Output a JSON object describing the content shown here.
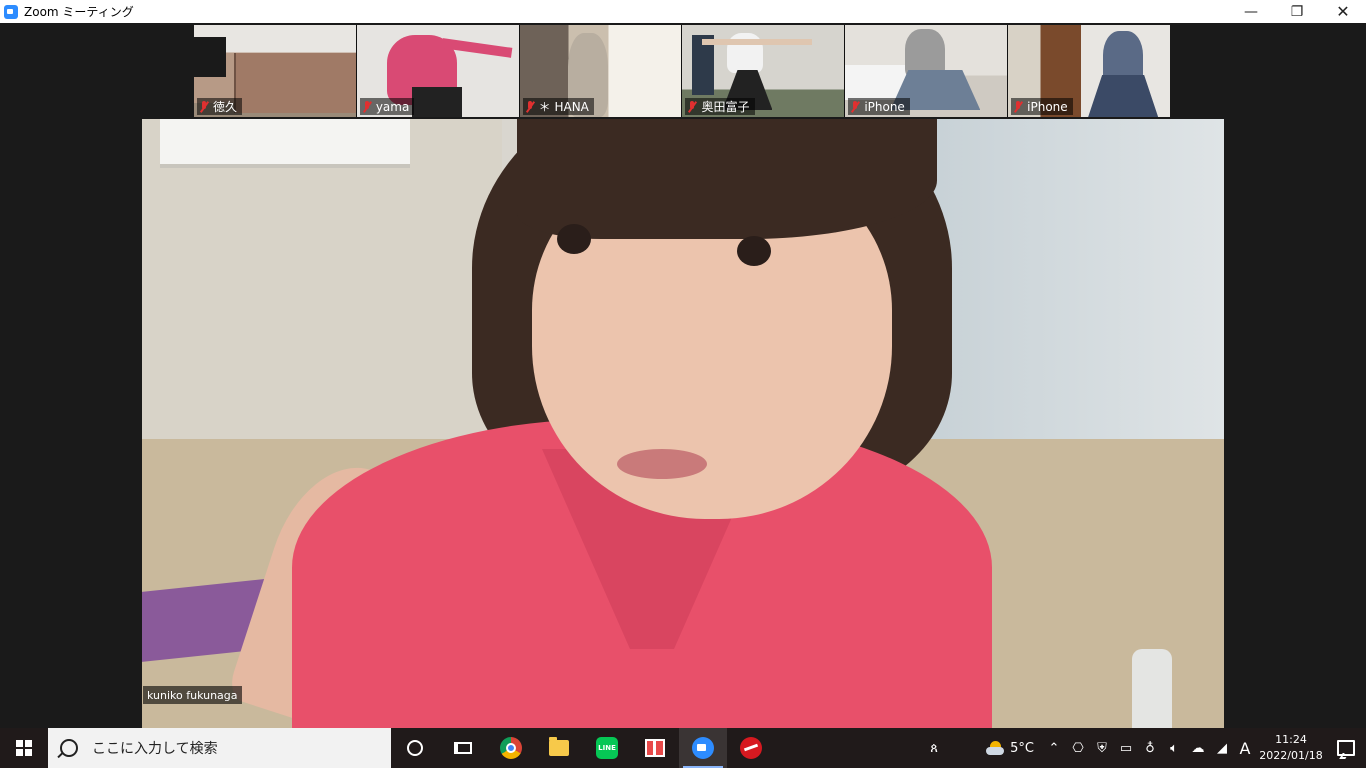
{
  "window": {
    "title": "Zoom ミーティング",
    "minimize": "—",
    "maximize": "❐",
    "close": "✕"
  },
  "gallery": {
    "participants": [
      {
        "name": "徳久",
        "muted": true
      },
      {
        "name": "yama",
        "muted": true
      },
      {
        "name": "＊ HANA",
        "muted": true
      },
      {
        "name": "奥田富子",
        "muted": true
      },
      {
        "name": "iPhone",
        "muted": true
      },
      {
        "name": "iPhone",
        "muted": true
      }
    ]
  },
  "speaker": {
    "name": "kuniko fukunaga"
  },
  "taskbar": {
    "search_placeholder": "ここに入力して検索",
    "apps": [
      "cortana",
      "task-view",
      "chrome",
      "file-explorer",
      "line",
      "gift",
      "zoom",
      "trend-micro"
    ],
    "active_app": "zoom",
    "line_label": "LINE",
    "weather_temp": "5°C",
    "time": "11:24",
    "date": "2022/01/18",
    "ime": "A",
    "colors": {
      "zoom_blue": "#2D8CFF",
      "line_green": "#06C755"
    }
  }
}
